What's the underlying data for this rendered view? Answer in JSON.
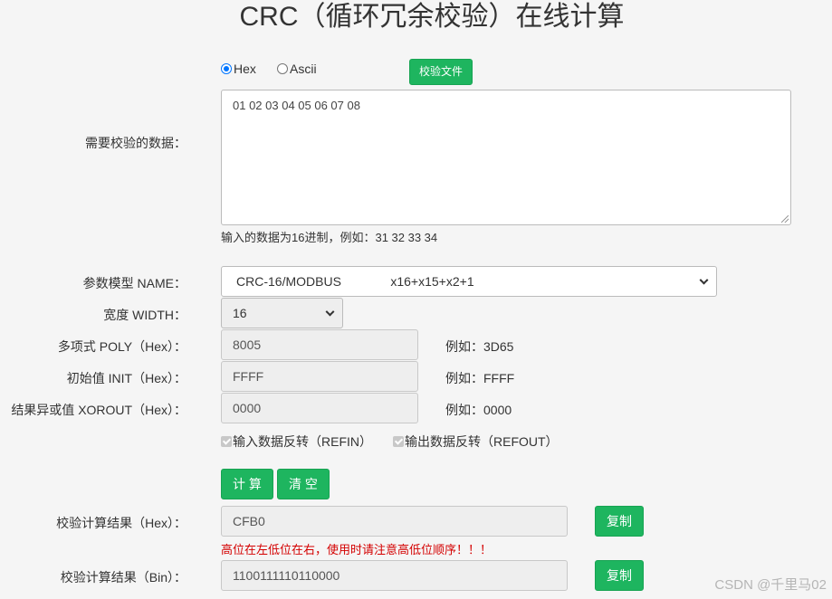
{
  "title": "CRC（循环冗余校验）在线计算",
  "format": {
    "options": [
      {
        "label": "Hex",
        "selected": true
      },
      {
        "label": "Ascii",
        "selected": false
      }
    ],
    "file_button": "校验文件"
  },
  "data_input": {
    "label": "需要校验的数据：",
    "value": "01 02 03 04 05 06 07 08",
    "hint": "输入的数据为16进制，例如：31 32 33 34"
  },
  "params": {
    "model": {
      "label": "参数模型 NAME：",
      "value": "CRC-16/MODBUS              x16+x15+x2+1"
    },
    "width": {
      "label": "宽度 WIDTH：",
      "value": "16"
    },
    "poly": {
      "label": "多项式 POLY（Hex）：",
      "value": "8005",
      "example": "例如：3D65"
    },
    "init": {
      "label": "初始值 INIT（Hex）：",
      "value": "FFFF",
      "example": "例如：FFFF"
    },
    "xorout": {
      "label": "结果异或值 XOROUT（Hex）：",
      "value": "0000",
      "example": "例如：0000"
    },
    "refin": {
      "label": "输入数据反转（REFIN）",
      "checked": true
    },
    "refout": {
      "label": "输出数据反转（REFOUT）",
      "checked": true
    }
  },
  "actions": {
    "calc": "计 算",
    "clear": "清 空"
  },
  "results": {
    "hex": {
      "label": "校验计算结果（Hex）：",
      "value": "CFB0",
      "copy": "复制"
    },
    "warning": "高位在左低位在右，使用时请注意高低位顺序！！！",
    "bin": {
      "label": "校验计算结果（Bin）：",
      "value": "1100111110110000",
      "copy": "复制"
    }
  },
  "watermark": "CSDN @千里马02",
  "colors": {
    "accent": "#1eb55f",
    "warning": "#d40000",
    "radio": "#0075ff"
  }
}
